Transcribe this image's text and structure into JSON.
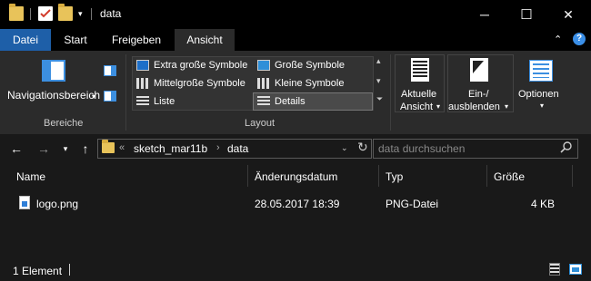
{
  "window": {
    "title": "data",
    "buttons": {
      "minimize": "─",
      "maximize": "☐",
      "close": "✕"
    }
  },
  "ribbon": {
    "tabs": {
      "file": "Datei",
      "start": "Start",
      "share": "Freigeben",
      "view": "Ansicht"
    },
    "groups": {
      "panes": {
        "label": "Bereiche",
        "nav_pane": "Navigationsbereich"
      },
      "layout": {
        "label": "Layout",
        "items": {
          "extra_large": "Extra große Symbole",
          "large": "Große Symbole",
          "medium": "Mittelgroße Symbole",
          "small": "Kleine Symbole",
          "list": "Liste",
          "details": "Details"
        }
      },
      "current_view": {
        "line1": "Aktuelle",
        "line2": "Ansicht"
      },
      "show_hide": {
        "line1": "Ein-/",
        "line2": "ausblenden"
      },
      "options": "Optionen"
    }
  },
  "nav": {
    "breadcrumb": {
      "overflow": "«",
      "parent": "sketch_mar11b",
      "current": "data"
    },
    "search_placeholder": "data durchsuchen"
  },
  "columns": {
    "name": "Name",
    "modified": "Änderungsdatum",
    "type": "Typ",
    "size": "Größe"
  },
  "files": [
    {
      "name": "logo.png",
      "modified": "28.05.2017 18:39",
      "type": "PNG-Datei",
      "size": "4 KB"
    }
  ],
  "status": {
    "count": "1 Element"
  }
}
